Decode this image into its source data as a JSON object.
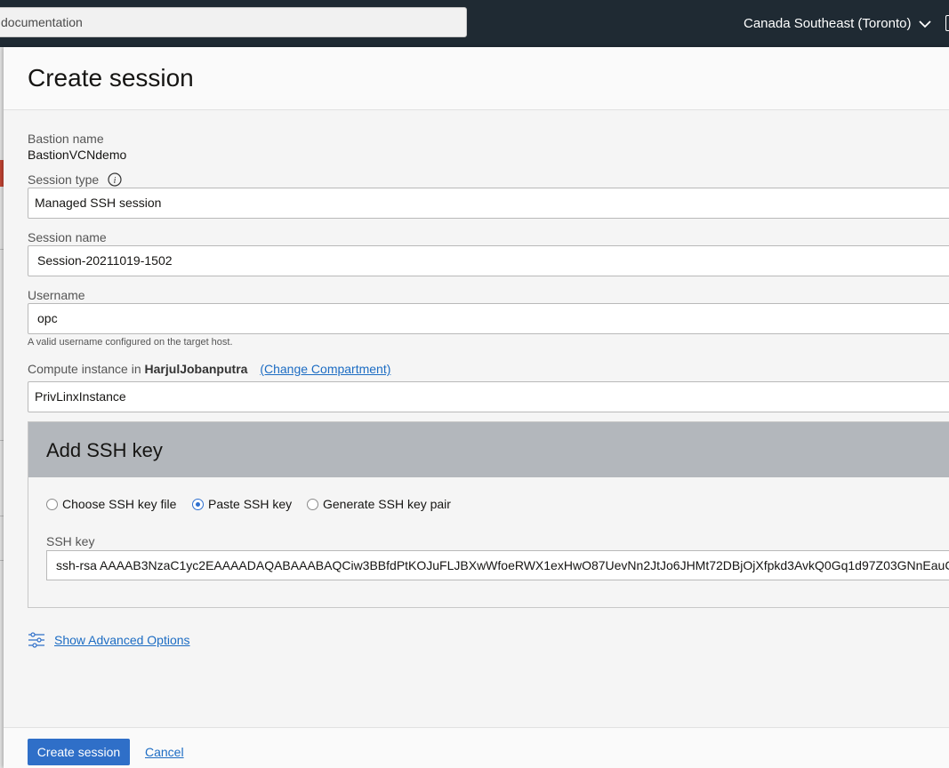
{
  "topbar": {
    "search_text": "documentation",
    "region": "Canada Southeast (Toronto)"
  },
  "panel": {
    "title": "Create session",
    "bastion_name_label": "Bastion name",
    "bastion_name_value": "BastionVCNdemo",
    "session_type_label": "Session type",
    "session_type_value": "Managed SSH session",
    "session_name_label": "Session name",
    "session_name_value": "Session-20211019-1502",
    "username_label": "Username",
    "username_value": "opc",
    "username_hint": "A valid username configured on the target host.",
    "compute_label": "Compute instance in",
    "compartment_name": "HarjulJobanputra",
    "change_compartment": "(Change Compartment)",
    "compute_value": "PrivLinxInstance"
  },
  "ssh": {
    "title": "Add SSH key",
    "options": [
      {
        "label": "Choose SSH key file",
        "checked": false
      },
      {
        "label": "Paste SSH key",
        "checked": true
      },
      {
        "label": "Generate SSH key pair",
        "checked": false
      }
    ],
    "key_label": "SSH key",
    "key_value": "ssh-rsa AAAAB3NzaC1yc2EAAAADAQABAAABAQCiw3BBfdPtKOJuFLJBXwWfoeRWX1exHwO87UevNn2JtJo6JHMt72DBjOjXfpkd3AvkQ0Gq1d97Z03GNnEauC"
  },
  "advanced": {
    "label": "Show Advanced Options",
    "icon": "sliders-icon"
  },
  "footer": {
    "create_label": "Create session",
    "cancel_label": "Cancel"
  },
  "colors": {
    "topbar": "#1f2a33",
    "primary": "#2f6fc8",
    "link": "#1c6cc3",
    "card_header": "#b3b7bc"
  }
}
